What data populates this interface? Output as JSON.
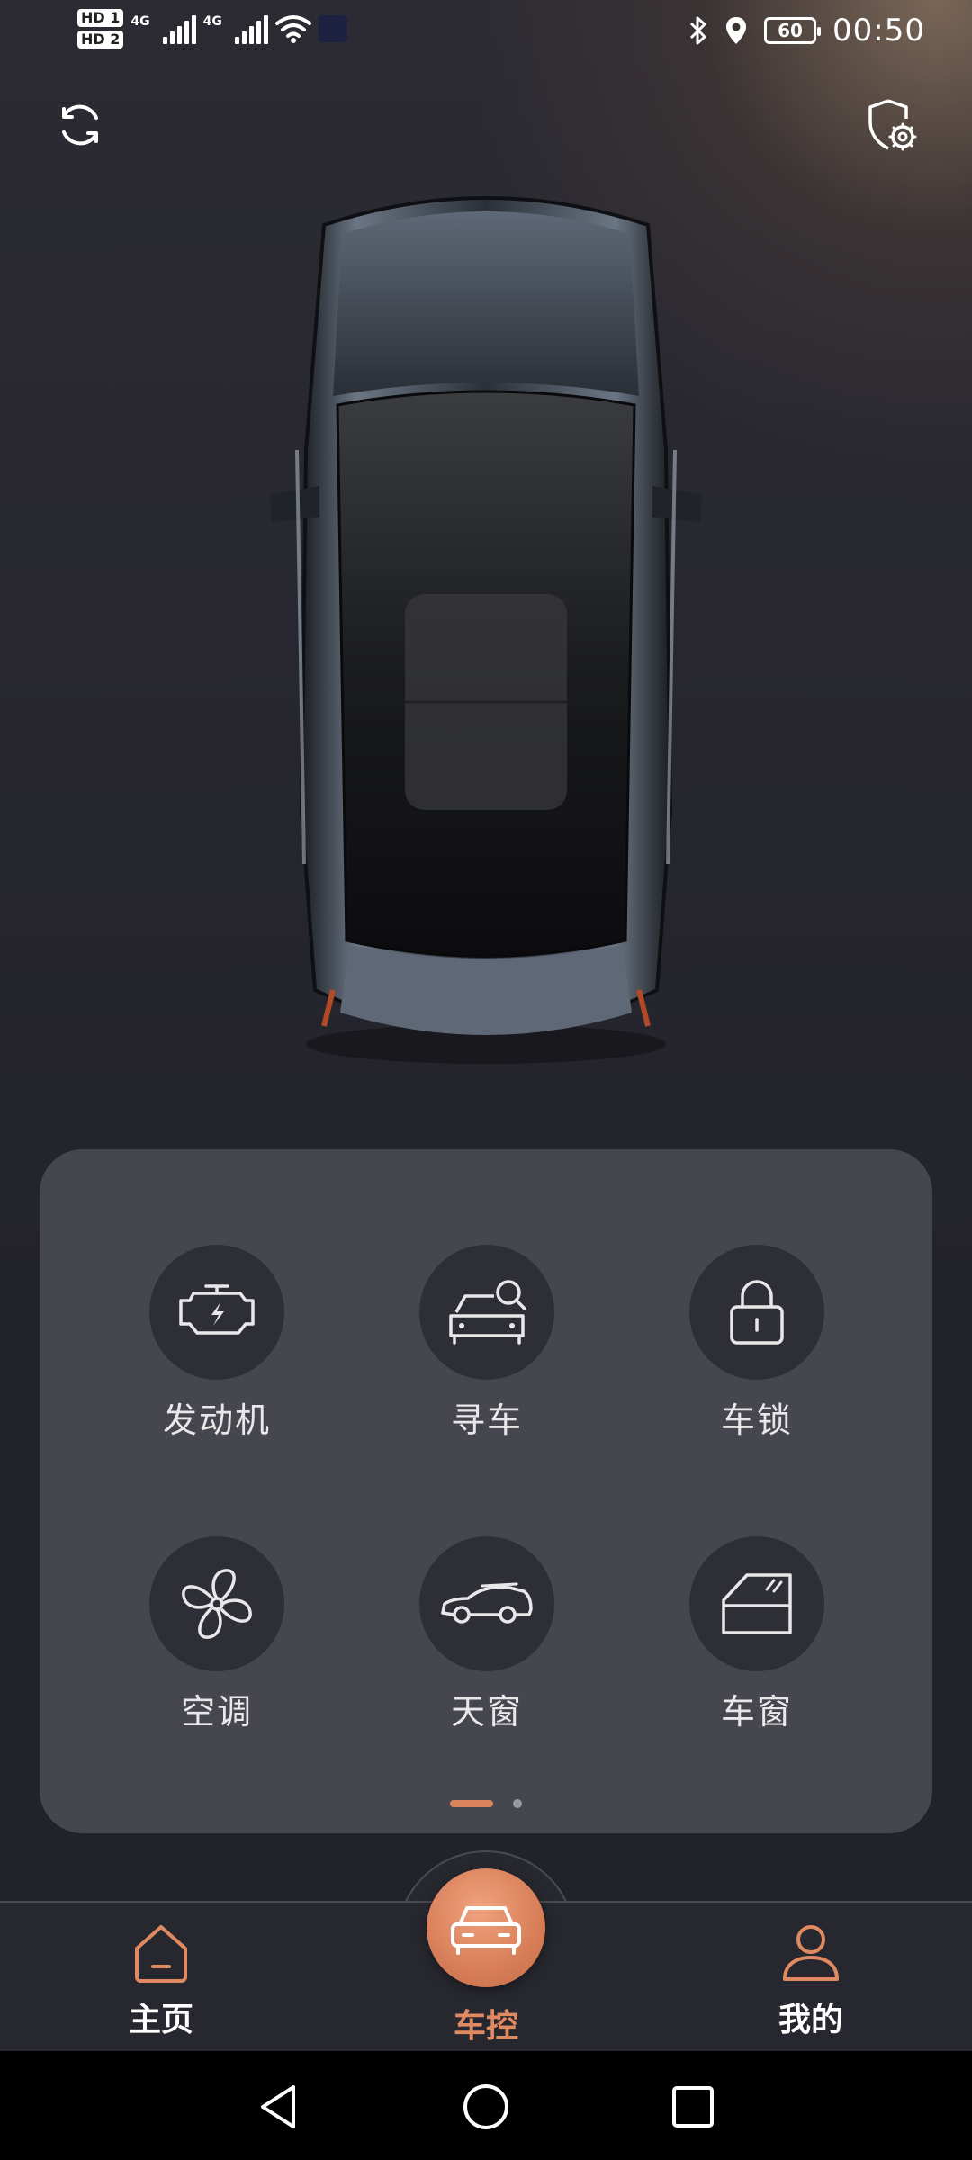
{
  "status_bar": {
    "sim1": "HD 1",
    "sim2": "HD 2",
    "network1": "4G",
    "network2": "4G",
    "battery": "60",
    "time": "00:50"
  },
  "top": {
    "refresh_icon": "refresh-icon",
    "settings_icon": "settings-shield-icon"
  },
  "controls": {
    "row1": [
      {
        "label": "发动机",
        "icon": "engine-icon"
      },
      {
        "label": "寻车",
        "icon": "find-car-icon"
      },
      {
        "label": "车锁",
        "icon": "lock-icon"
      }
    ],
    "row2": [
      {
        "label": "空调",
        "icon": "fan-icon"
      },
      {
        "label": "天窗",
        "icon": "sunroof-car-icon"
      },
      {
        "label": "车窗",
        "icon": "window-icon"
      }
    ],
    "page_indicator": {
      "current": 1,
      "total": 2
    }
  },
  "bottom_nav": {
    "home": "主页",
    "car_control": "车控",
    "mine": "我的"
  },
  "colors": {
    "accent": "#d9835f",
    "card": "#46464f",
    "background": "#25252d"
  }
}
